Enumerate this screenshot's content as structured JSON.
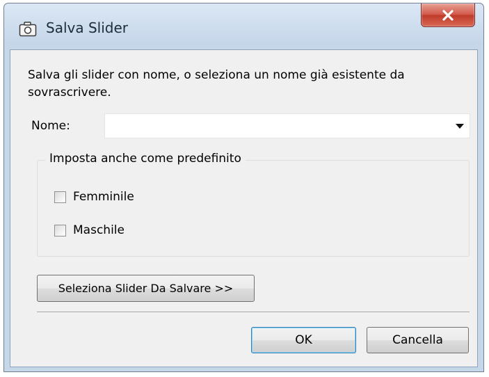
{
  "window": {
    "title": "Salva Slider",
    "icon": "camera-icon",
    "close_icon": "close-icon"
  },
  "description": "Salva gli slider con nome, o seleziona un nome già esistente da sovrascrivere.",
  "name_field": {
    "label": "Nome:",
    "value": ""
  },
  "defaults_group": {
    "title": "Imposta anche come predefinito",
    "options": [
      {
        "label": "Femminile",
        "checked": false
      },
      {
        "label": "Maschile",
        "checked": false
      }
    ]
  },
  "select_sliders_button": "Seleziona Slider Da Salvare >>",
  "buttons": {
    "ok": "OK",
    "cancel": "Cancella"
  },
  "colors": {
    "close_button": "#c8412f",
    "dialog_background": "#f0f0f0",
    "frame": "#c6d7ea"
  }
}
